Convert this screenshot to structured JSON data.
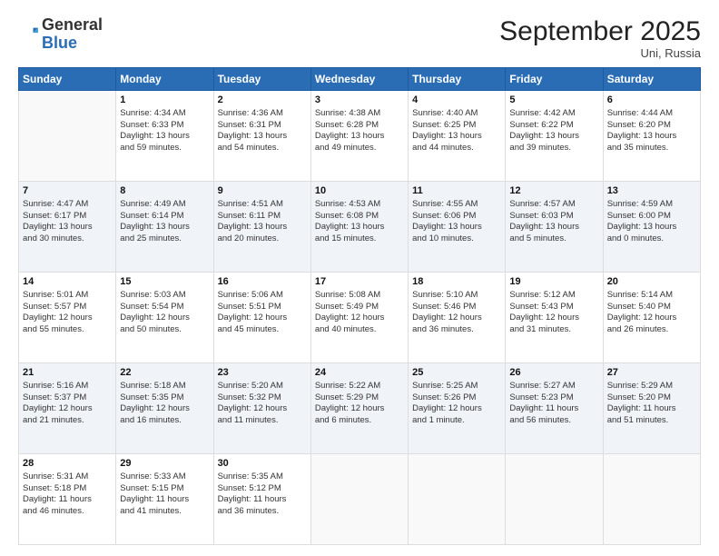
{
  "header": {
    "logo_general": "General",
    "logo_blue": "Blue",
    "month": "September 2025",
    "location": "Uni, Russia"
  },
  "weekdays": [
    "Sunday",
    "Monday",
    "Tuesday",
    "Wednesday",
    "Thursday",
    "Friday",
    "Saturday"
  ],
  "weeks": [
    [
      {
        "day": "",
        "info": ""
      },
      {
        "day": "1",
        "info": "Sunrise: 4:34 AM\nSunset: 6:33 PM\nDaylight: 13 hours\nand 59 minutes."
      },
      {
        "day": "2",
        "info": "Sunrise: 4:36 AM\nSunset: 6:31 PM\nDaylight: 13 hours\nand 54 minutes."
      },
      {
        "day": "3",
        "info": "Sunrise: 4:38 AM\nSunset: 6:28 PM\nDaylight: 13 hours\nand 49 minutes."
      },
      {
        "day": "4",
        "info": "Sunrise: 4:40 AM\nSunset: 6:25 PM\nDaylight: 13 hours\nand 44 minutes."
      },
      {
        "day": "5",
        "info": "Sunrise: 4:42 AM\nSunset: 6:22 PM\nDaylight: 13 hours\nand 39 minutes."
      },
      {
        "day": "6",
        "info": "Sunrise: 4:44 AM\nSunset: 6:20 PM\nDaylight: 13 hours\nand 35 minutes."
      }
    ],
    [
      {
        "day": "7",
        "info": "Sunrise: 4:47 AM\nSunset: 6:17 PM\nDaylight: 13 hours\nand 30 minutes."
      },
      {
        "day": "8",
        "info": "Sunrise: 4:49 AM\nSunset: 6:14 PM\nDaylight: 13 hours\nand 25 minutes."
      },
      {
        "day": "9",
        "info": "Sunrise: 4:51 AM\nSunset: 6:11 PM\nDaylight: 13 hours\nand 20 minutes."
      },
      {
        "day": "10",
        "info": "Sunrise: 4:53 AM\nSunset: 6:08 PM\nDaylight: 13 hours\nand 15 minutes."
      },
      {
        "day": "11",
        "info": "Sunrise: 4:55 AM\nSunset: 6:06 PM\nDaylight: 13 hours\nand 10 minutes."
      },
      {
        "day": "12",
        "info": "Sunrise: 4:57 AM\nSunset: 6:03 PM\nDaylight: 13 hours\nand 5 minutes."
      },
      {
        "day": "13",
        "info": "Sunrise: 4:59 AM\nSunset: 6:00 PM\nDaylight: 13 hours\nand 0 minutes."
      }
    ],
    [
      {
        "day": "14",
        "info": "Sunrise: 5:01 AM\nSunset: 5:57 PM\nDaylight: 12 hours\nand 55 minutes."
      },
      {
        "day": "15",
        "info": "Sunrise: 5:03 AM\nSunset: 5:54 PM\nDaylight: 12 hours\nand 50 minutes."
      },
      {
        "day": "16",
        "info": "Sunrise: 5:06 AM\nSunset: 5:51 PM\nDaylight: 12 hours\nand 45 minutes."
      },
      {
        "day": "17",
        "info": "Sunrise: 5:08 AM\nSunset: 5:49 PM\nDaylight: 12 hours\nand 40 minutes."
      },
      {
        "day": "18",
        "info": "Sunrise: 5:10 AM\nSunset: 5:46 PM\nDaylight: 12 hours\nand 36 minutes."
      },
      {
        "day": "19",
        "info": "Sunrise: 5:12 AM\nSunset: 5:43 PM\nDaylight: 12 hours\nand 31 minutes."
      },
      {
        "day": "20",
        "info": "Sunrise: 5:14 AM\nSunset: 5:40 PM\nDaylight: 12 hours\nand 26 minutes."
      }
    ],
    [
      {
        "day": "21",
        "info": "Sunrise: 5:16 AM\nSunset: 5:37 PM\nDaylight: 12 hours\nand 21 minutes."
      },
      {
        "day": "22",
        "info": "Sunrise: 5:18 AM\nSunset: 5:35 PM\nDaylight: 12 hours\nand 16 minutes."
      },
      {
        "day": "23",
        "info": "Sunrise: 5:20 AM\nSunset: 5:32 PM\nDaylight: 12 hours\nand 11 minutes."
      },
      {
        "day": "24",
        "info": "Sunrise: 5:22 AM\nSunset: 5:29 PM\nDaylight: 12 hours\nand 6 minutes."
      },
      {
        "day": "25",
        "info": "Sunrise: 5:25 AM\nSunset: 5:26 PM\nDaylight: 12 hours\nand 1 minute."
      },
      {
        "day": "26",
        "info": "Sunrise: 5:27 AM\nSunset: 5:23 PM\nDaylight: 11 hours\nand 56 minutes."
      },
      {
        "day": "27",
        "info": "Sunrise: 5:29 AM\nSunset: 5:20 PM\nDaylight: 11 hours\nand 51 minutes."
      }
    ],
    [
      {
        "day": "28",
        "info": "Sunrise: 5:31 AM\nSunset: 5:18 PM\nDaylight: 11 hours\nand 46 minutes."
      },
      {
        "day": "29",
        "info": "Sunrise: 5:33 AM\nSunset: 5:15 PM\nDaylight: 11 hours\nand 41 minutes."
      },
      {
        "day": "30",
        "info": "Sunrise: 5:35 AM\nSunset: 5:12 PM\nDaylight: 11 hours\nand 36 minutes."
      },
      {
        "day": "",
        "info": ""
      },
      {
        "day": "",
        "info": ""
      },
      {
        "day": "",
        "info": ""
      },
      {
        "day": "",
        "info": ""
      }
    ]
  ]
}
